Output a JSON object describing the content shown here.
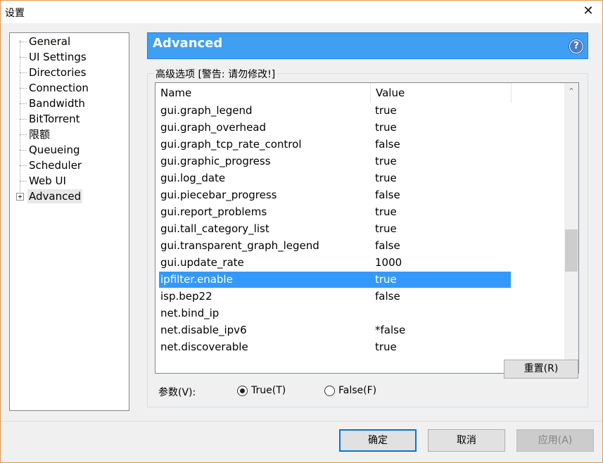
{
  "window": {
    "title": "设置",
    "close_glyph": "✕"
  },
  "sidebar": {
    "items": [
      {
        "label": "General"
      },
      {
        "label": "UI Settings"
      },
      {
        "label": "Directories"
      },
      {
        "label": "Connection"
      },
      {
        "label": "Bandwidth"
      },
      {
        "label": "BitTorrent"
      },
      {
        "label": "限额"
      },
      {
        "label": "Queueing"
      },
      {
        "label": "Scheduler"
      },
      {
        "label": "Web UI"
      },
      {
        "label": "Advanced",
        "selected": true,
        "expandable": true
      }
    ]
  },
  "banner": {
    "title": "Advanced",
    "help_glyph": "?"
  },
  "group": {
    "legend": "高级选项 [警告: 请勿修改!]"
  },
  "table": {
    "columns": [
      "Name",
      "Value"
    ],
    "rows": [
      {
        "name": "gui.graph_legend",
        "value": "true"
      },
      {
        "name": "gui.graph_overhead",
        "value": "true"
      },
      {
        "name": "gui.graph_tcp_rate_control",
        "value": "false"
      },
      {
        "name": "gui.graphic_progress",
        "value": "true"
      },
      {
        "name": "gui.log_date",
        "value": "true"
      },
      {
        "name": "gui.piecebar_progress",
        "value": "false"
      },
      {
        "name": "gui.report_problems",
        "value": "true"
      },
      {
        "name": "gui.tall_category_list",
        "value": "true"
      },
      {
        "name": "gui.transparent_graph_legend",
        "value": "false"
      },
      {
        "name": "gui.update_rate",
        "value": "1000"
      },
      {
        "name": "ipfilter.enable",
        "value": "true",
        "selected": true
      },
      {
        "name": "isp.bep22",
        "value": "false"
      },
      {
        "name": "net.bind_ip",
        "value": ""
      },
      {
        "name": "net.disable_ipv6",
        "value": "*false"
      },
      {
        "name": "net.discoverable",
        "value": "true"
      }
    ],
    "scroll_up_glyph": "⌃",
    "scroll_down_glyph": "⌄"
  },
  "param": {
    "label": "参数(V):",
    "true_label": "True(T)",
    "false_label": "False(F)",
    "selected": "true",
    "reset_label": "重置(R)"
  },
  "footer": {
    "ok_label": "确定",
    "cancel_label": "取消",
    "apply_label": "应用(A)"
  },
  "colors": {
    "banner": "#3f9ff3",
    "selection": "#3399ff",
    "window_border": "#e3964a"
  }
}
